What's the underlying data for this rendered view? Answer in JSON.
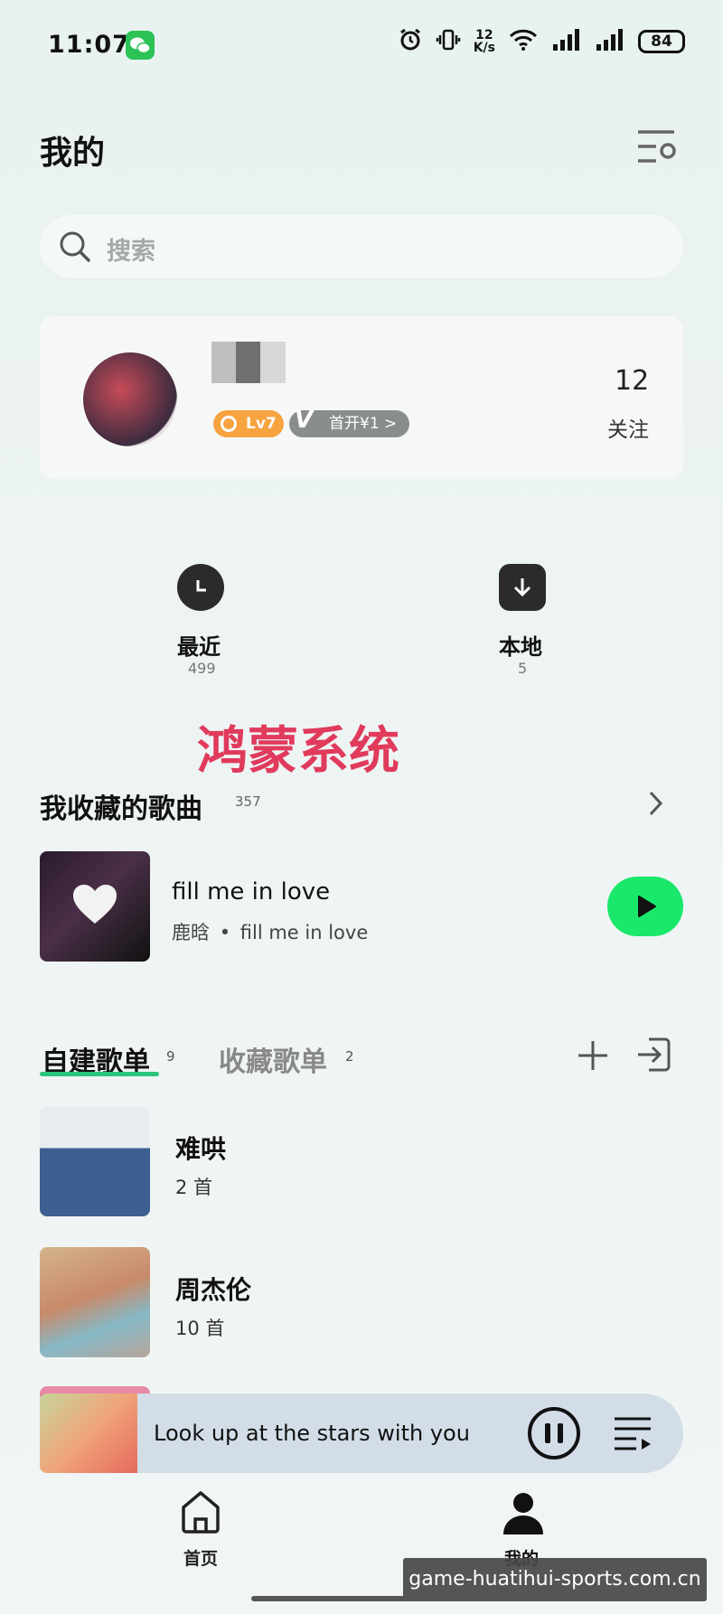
{
  "status_bar": {
    "time": "11:07",
    "net_speed_value": "12",
    "net_speed_unit": "K/s",
    "battery": "84"
  },
  "header": {
    "title": "我的"
  },
  "search": {
    "placeholder": "搜索"
  },
  "profile": {
    "level_badge": "Lv7",
    "vip_badge": "首开¥1 >",
    "follow_count": "12",
    "follow_label": "关注"
  },
  "quick_access": [
    {
      "label": "最近",
      "count": "499",
      "icon": "clock-icon"
    },
    {
      "label": "本地",
      "count": "5",
      "icon": "download-icon"
    }
  ],
  "overlay_text": "鸿蒙系统",
  "favorites": {
    "title": "我收藏的歌曲",
    "count": "357",
    "song_title": "fill me in love",
    "artist": "鹿晗",
    "album": "fill me in love",
    "separator": "•"
  },
  "playlist_tabs": {
    "created_label": "自建歌单",
    "created_count": "9",
    "collected_label": "收藏歌单",
    "collected_count": "2"
  },
  "playlists": [
    {
      "name": "难哄",
      "count": "2 首"
    },
    {
      "name": "周杰伦",
      "count": "10 首"
    }
  ],
  "mini_player": {
    "title": "Look up at the stars with you"
  },
  "bottom_nav": {
    "home_label": "首页",
    "me_label": "我的"
  },
  "site_watermark": "game-huatihui-sports.com.cn",
  "colors": {
    "accent_green": "#19e86a",
    "tab_underline": "#2bc47c",
    "overlay_red": "#e03a5c",
    "level_orange": "#f7a340"
  }
}
